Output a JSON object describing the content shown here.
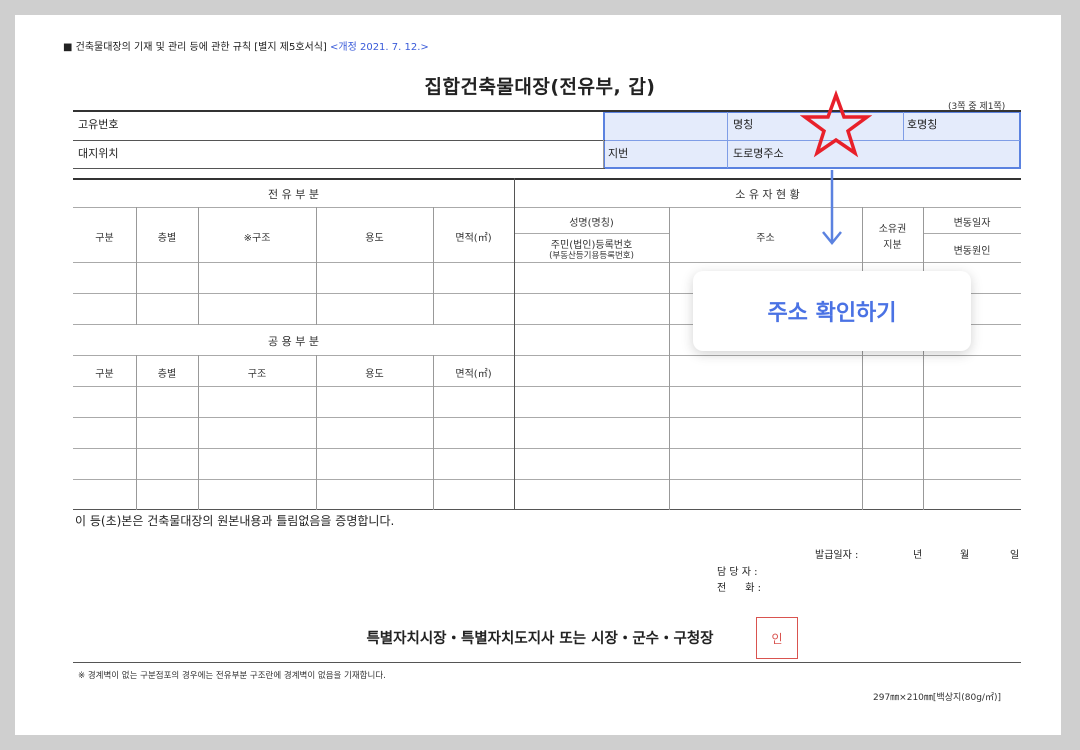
{
  "header": {
    "form_ref": "■ 건축물대장의 기재 및 관리 등에 관한 규칙 [별지 제5호서식]",
    "revision": "<개정 2021. 7. 12.>",
    "title": "집합건축물대장(전유부, 갑)",
    "page_note": "(3쪽 중 제1쪽)"
  },
  "top_fields": {
    "unique_no": "고유번호",
    "name": "명칭",
    "unit_name": "호명칭",
    "site_location": "대지위치",
    "lot_no": "지번",
    "road_address": "도로명주소"
  },
  "exclusive": {
    "heading": "전 유 부 분",
    "columns": [
      "구분",
      "층별",
      "※구조",
      "용도",
      "면적(㎡)"
    ]
  },
  "ownership": {
    "heading": "소 유 자 현 황",
    "name_label": "성명(명칭)",
    "reg_no_label": "주민(법인)등록번호",
    "reg_no_sub": "(부동산등기용등록번호)",
    "address_label": "주소",
    "share_label_1": "소유권",
    "share_label_2": "지분",
    "change_date": "변동일자",
    "change_reason": "변동원인"
  },
  "common": {
    "heading": "공 용 부 분",
    "columns": [
      "구분",
      "층별",
      "구조",
      "용도",
      "면적(㎡)"
    ]
  },
  "certify": "이 등(초)본은 건축물대장의 원본내용과 틀림없음을 증명합니다.",
  "issue": {
    "date_label": "발급일자 :",
    "year": "년",
    "month": "월",
    "day": "일",
    "officer": "담 당 자 :",
    "phone": "전      화 :"
  },
  "signature": {
    "title": "특별자치시장・특별자치도지사 또는 시장・군수・구청장",
    "seal": "인"
  },
  "footnote": "※ 경계벽이 없는 구분점포의 경우에는 전유부분 구조란에 경계벽이 없음을 기재합니다.",
  "paper_size": "297㎜×210㎜[백상지(80g/㎡)]",
  "overlay": {
    "callout_text": "주소 확인하기",
    "accent_color": "#4a72e4",
    "star_color": "#e8202a",
    "star_icon": "star-outline-icon",
    "arrow_icon": "arrow-down-icon"
  }
}
